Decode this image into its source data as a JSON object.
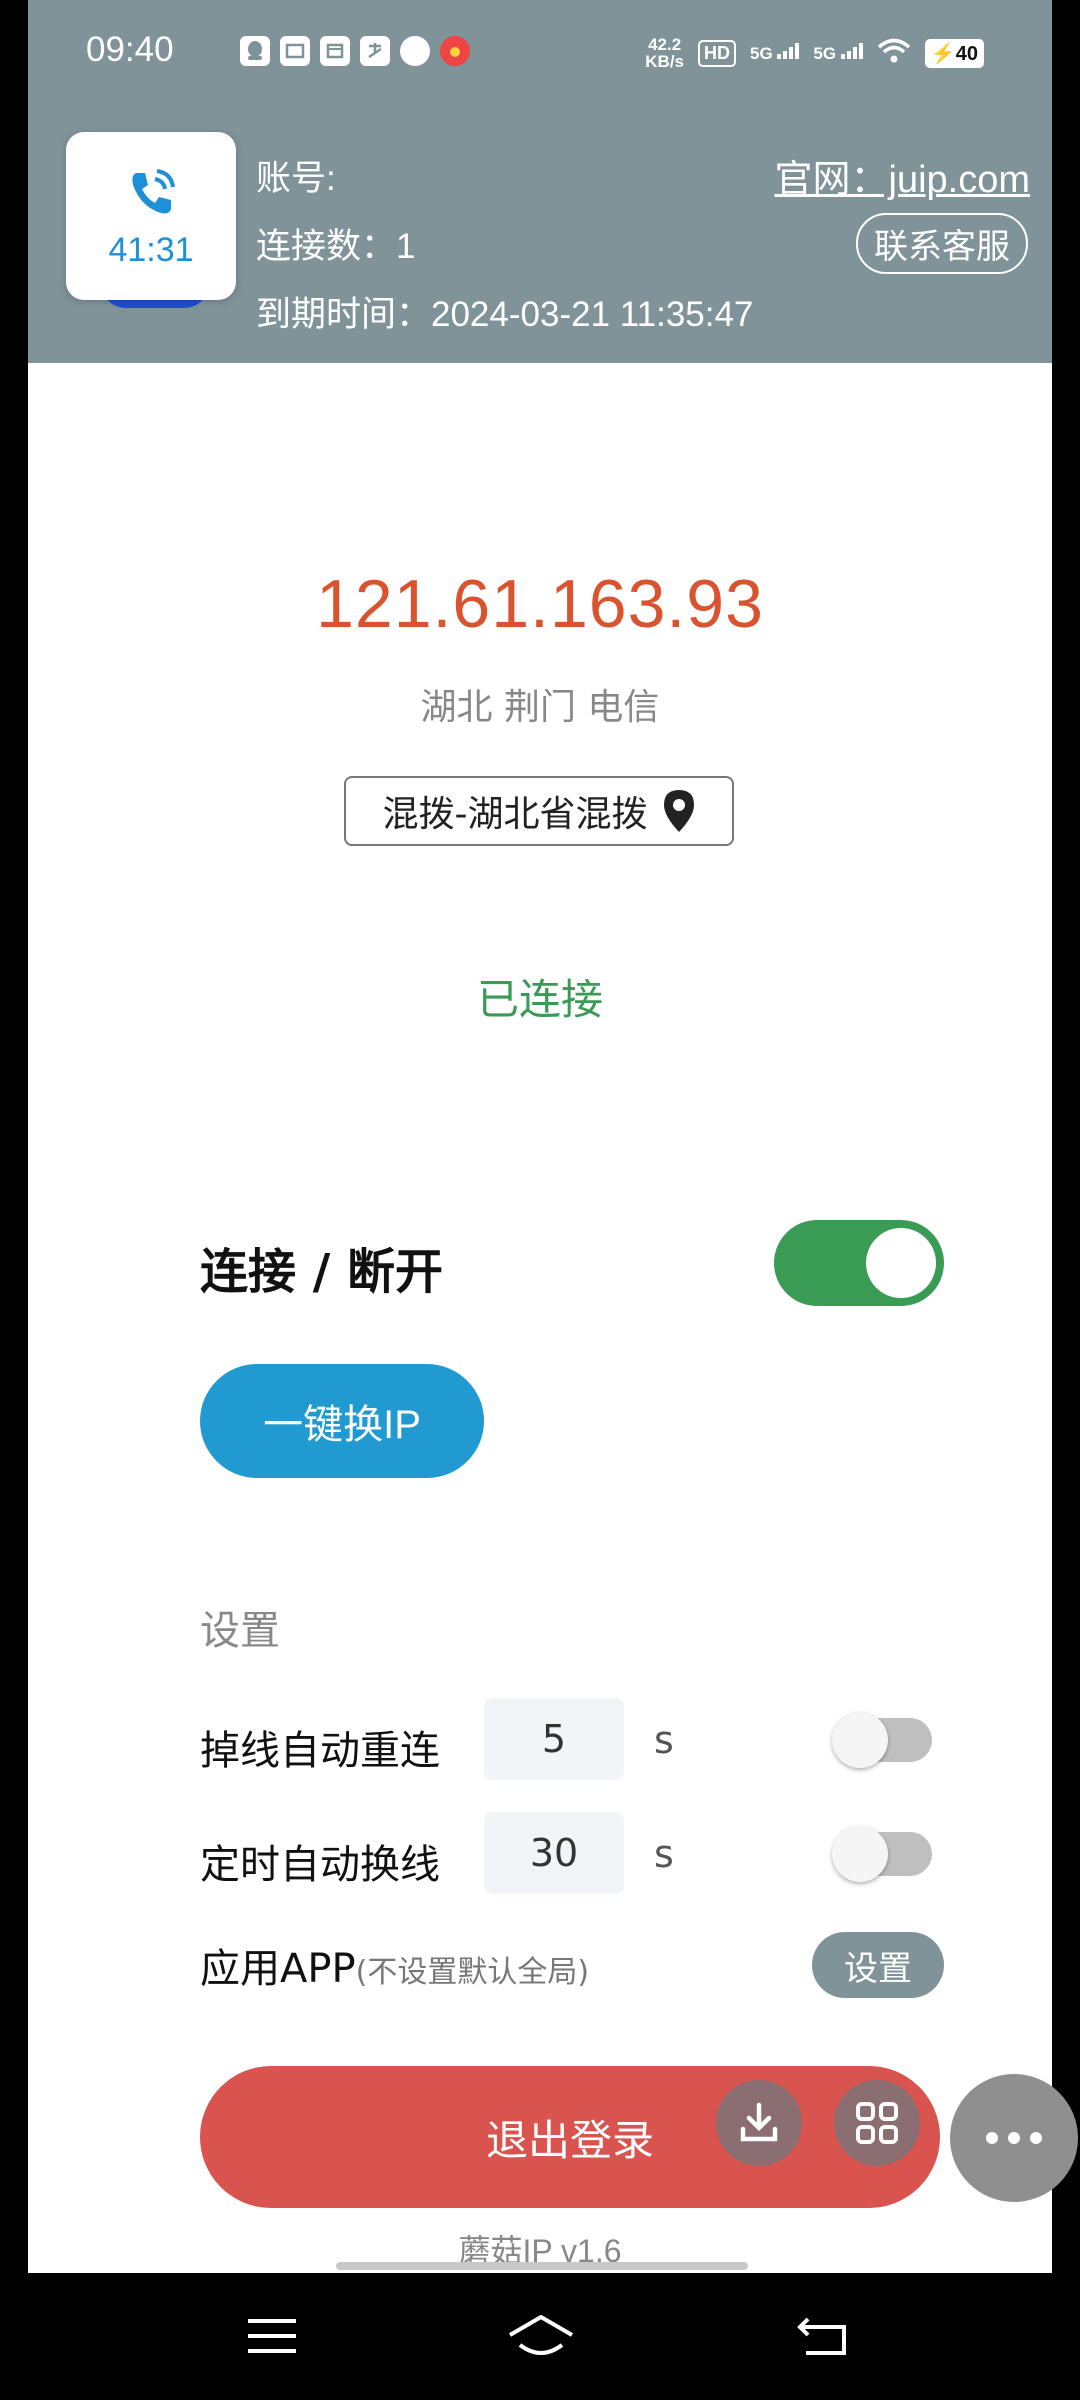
{
  "status_bar": {
    "time": "09:40",
    "net_speed_value": "42.2",
    "net_speed_unit": "KB/s",
    "hd_label": "HD",
    "sim1": "5G",
    "sim2": "5G",
    "battery": "40"
  },
  "call": {
    "duration": "41:31"
  },
  "account": {
    "label": "账号:",
    "connections": "连接数：1",
    "expiry": "到期时间：2024-03-21 11:35:47",
    "website": "官网：juip.com",
    "contact_button": "联系客服"
  },
  "connection": {
    "ip": "121.61.163.93",
    "location": "湖北 荆门  电信",
    "region": "混拨-湖北省混拨",
    "status": "已连接",
    "status_color": "#3a9b55",
    "toggle_label": "连接 / 断开",
    "toggle_on": true,
    "switch_ip_button": "一键换IP"
  },
  "settings": {
    "heading": "设置",
    "reconnect_label": "掉线自动重连",
    "reconnect_value": "5",
    "reconnect_unit": "s",
    "reconnect_enabled": false,
    "switch_label": "定时自动换线",
    "switch_value": "30",
    "switch_unit": "s",
    "switch_enabled": false,
    "app_label": "应用APP",
    "app_note": "(不设置默认全局)",
    "app_button": "设置"
  },
  "logout_button": "退出登录",
  "version": "蘑菇IP v1.6",
  "colors": {
    "header": "#7f9399",
    "ip": "#d9532f",
    "accent_blue": "#209ad0",
    "logout": "#d9534f"
  }
}
